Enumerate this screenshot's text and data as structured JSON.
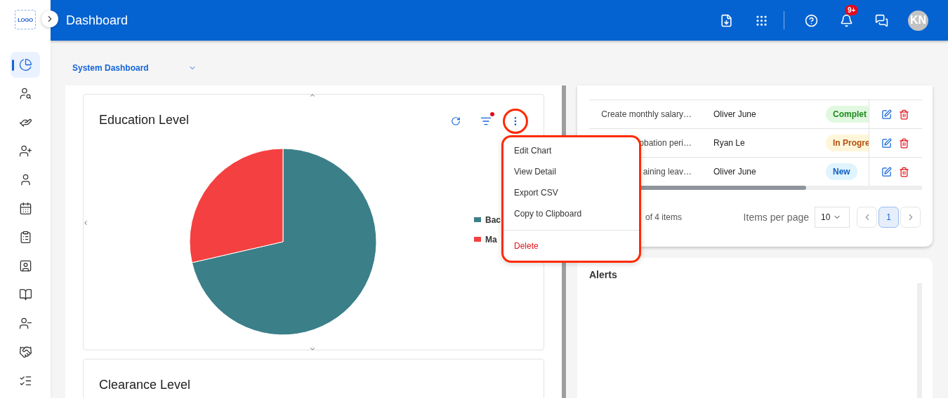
{
  "sidebar": {
    "logo": "LOGO",
    "items": [
      {
        "selected": true
      },
      {
        "selected": false
      },
      {
        "selected": false
      },
      {
        "selected": false
      },
      {
        "selected": false
      },
      {
        "selected": false
      },
      {
        "selected": false
      },
      {
        "selected": false
      },
      {
        "selected": false
      },
      {
        "selected": false
      },
      {
        "selected": false
      },
      {
        "selected": false
      }
    ]
  },
  "header": {
    "title": "Dashboard",
    "notifications_badge": "9+",
    "avatar": "KN"
  },
  "dashboard_select": {
    "value": "System Dashboard"
  },
  "education_card": {
    "title": "Education Level",
    "filter_active": true,
    "legend": [
      {
        "label": "Bac",
        "color": "#3b7f89"
      },
      {
        "label": "Ma",
        "color": "#f44040"
      }
    ],
    "menu": [
      {
        "label": "Edit Chart",
        "kind": "normal"
      },
      {
        "label": "View Detail",
        "kind": "normal"
      },
      {
        "label": "Export CSV",
        "kind": "normal"
      },
      {
        "label": "Copy to Clipboard",
        "kind": "normal"
      },
      {
        "label": "Delete",
        "kind": "danger"
      }
    ]
  },
  "clearance_card": {
    "title": "Clearance Level"
  },
  "tasks_table": {
    "rows": [
      {
        "task": "Create monthly salary…",
        "assignee": "Oliver June",
        "status": "Complet",
        "kind": "completed"
      },
      {
        "task": "obation peri…",
        "assignee": "Ryan Le",
        "status": "In Progre",
        "kind": "in_progress"
      },
      {
        "task": "aining leav…",
        "assignee": "Oliver June",
        "status": "New",
        "kind": "new"
      }
    ],
    "summary": "of 4 items",
    "items_per_page_label": "Items per page",
    "items_per_page": "10",
    "pages": [
      {
        "label": "1",
        "selected": true
      }
    ]
  },
  "alerts": {
    "title": "Alerts"
  }
}
